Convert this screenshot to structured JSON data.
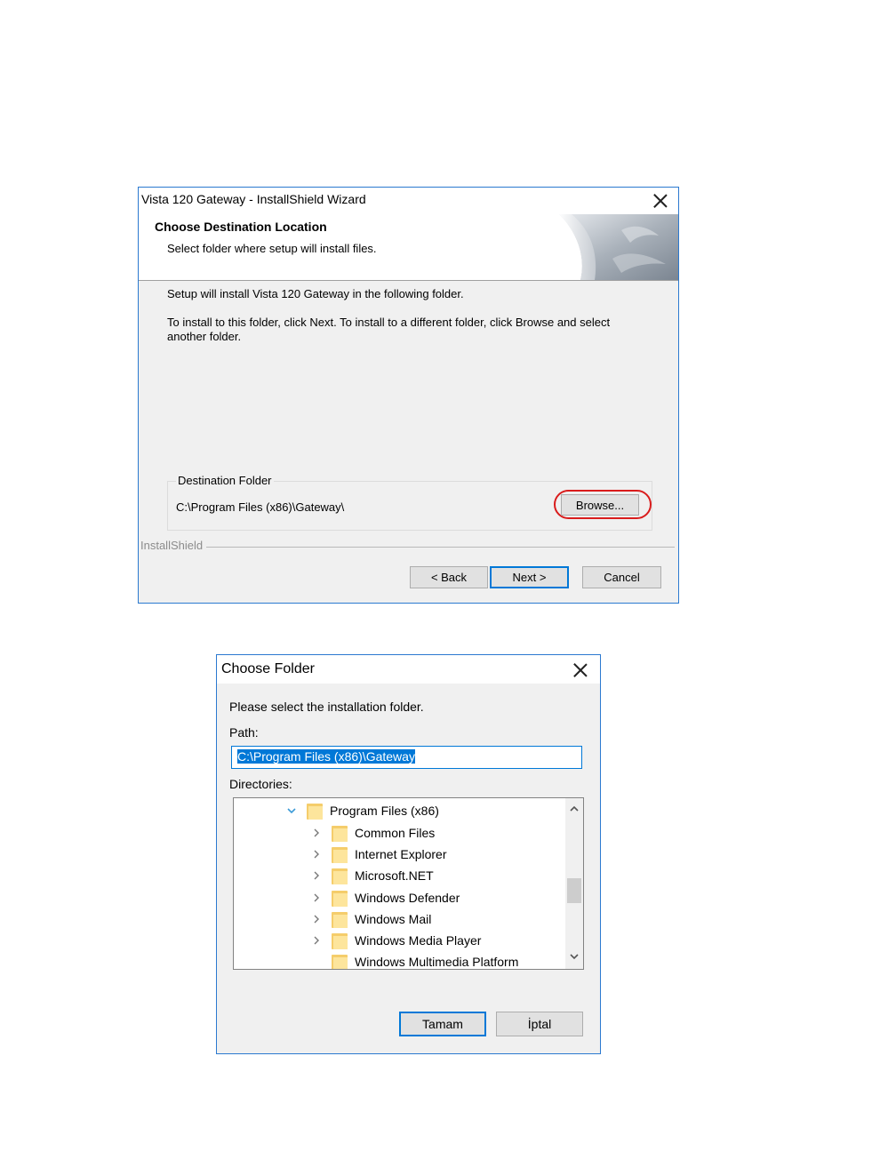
{
  "wizard": {
    "title": "Vista 120 Gateway - InstallShield Wizard",
    "header_title": "Choose Destination Location",
    "header_subtitle": "Select folder where setup will install files.",
    "line1": "Setup will install Vista 120 Gateway in the following folder.",
    "line2a": "To install to this folder, click Next. To install to a different folder, click Browse and select",
    "line2b": "another folder.",
    "group_label": "Destination Folder",
    "destination_path": "C:\\Program Files (x86)\\Gateway\\",
    "browse_label": "Browse...",
    "brand": "InstallShield",
    "back_label": "< Back",
    "next_label": "Next >",
    "cancel_label": "Cancel"
  },
  "choose_folder": {
    "title": "Choose Folder",
    "prompt": "Please select the installation folder.",
    "path_label": "Path:",
    "path_value": "C:\\Program Files (x86)\\Gateway",
    "directories_label": "Directories:",
    "tree": [
      {
        "label": "Program Files (x86)",
        "expanded": true
      },
      {
        "label": "Common Files",
        "expanded": false
      },
      {
        "label": "Internet Explorer",
        "expanded": false
      },
      {
        "label": "Microsoft.NET",
        "expanded": false
      },
      {
        "label": "Windows Defender",
        "expanded": false
      },
      {
        "label": "Windows Mail",
        "expanded": false
      },
      {
        "label": "Windows Media Player",
        "expanded": false
      },
      {
        "label": "Windows Multimedia Platform",
        "expanded": false
      }
    ],
    "ok_label": "Tamam",
    "cancel_label": "İptal"
  },
  "colors": {
    "accent": "#0078d7",
    "highlight_ring": "#d91c1c",
    "folder": "#f5cd6b"
  }
}
